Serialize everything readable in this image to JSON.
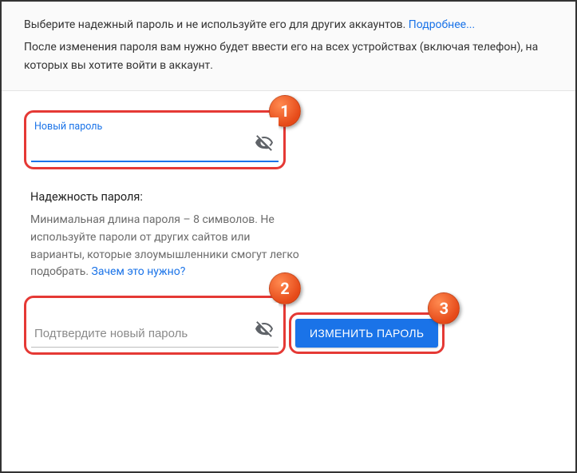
{
  "intro": {
    "line1_prefix": "Выберите надежный пароль и не используйте его для других аккаунтов. ",
    "learn_more": "Подробнее...",
    "line2": "После изменения пароля вам нужно будет ввести его на всех устройствах (включая телефон), на которых вы хотите войти в аккаунт."
  },
  "field1": {
    "label": "Новый пароль",
    "value": ""
  },
  "strength": {
    "title": "Надежность пароля:",
    "body": "Минимальная длина пароля – 8 символов. Не используйте пароли от других сайтов или варианты, которые злоумышленники смогут легко подобрать. ",
    "why_link": "Зачем это нужно?"
  },
  "field2": {
    "placeholder": "Подтвердите новый пароль",
    "value": ""
  },
  "submit_label": "ИЗМЕНИТЬ ПАРОЛЬ",
  "badges": {
    "b1": "1",
    "b2": "2",
    "b3": "3"
  }
}
